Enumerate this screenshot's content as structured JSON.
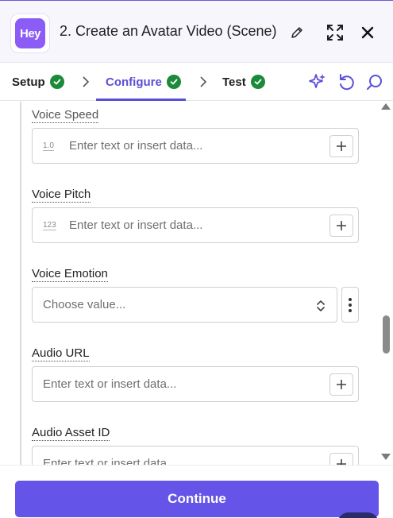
{
  "header": {
    "logo_text": "Hey",
    "title": "2. Create an Avatar Video (Scene)"
  },
  "tabs": [
    {
      "label": "Setup",
      "status": "complete"
    },
    {
      "label": "Configure",
      "status": "complete",
      "active": true
    },
    {
      "label": "Test",
      "status": "complete"
    }
  ],
  "fields": [
    {
      "label": "Voice Speed",
      "type_hint": "1.0",
      "placeholder": "Enter text or insert data..."
    },
    {
      "label": "Voice Pitch",
      "type_hint": "123",
      "placeholder": "Enter text or insert data..."
    },
    {
      "label": "Voice Emotion",
      "placeholder": "Choose value..."
    },
    {
      "label": "Audio URL",
      "placeholder": "Enter text or insert data..."
    },
    {
      "label": "Audio Asset ID",
      "placeholder": "Enter text or insert data..."
    }
  ],
  "footer": {
    "continue_label": "Continue"
  },
  "colors": {
    "accent": "#5b4fd6",
    "button": "#6554e8",
    "success": "#1b8a3a"
  },
  "icons": [
    "edit-icon",
    "expand-icon",
    "close-icon",
    "check-icon",
    "chevron-right-icon",
    "sparkle-icon",
    "undo-icon",
    "search-icon",
    "plus-icon",
    "select-arrows-icon",
    "more-vertical-icon"
  ]
}
